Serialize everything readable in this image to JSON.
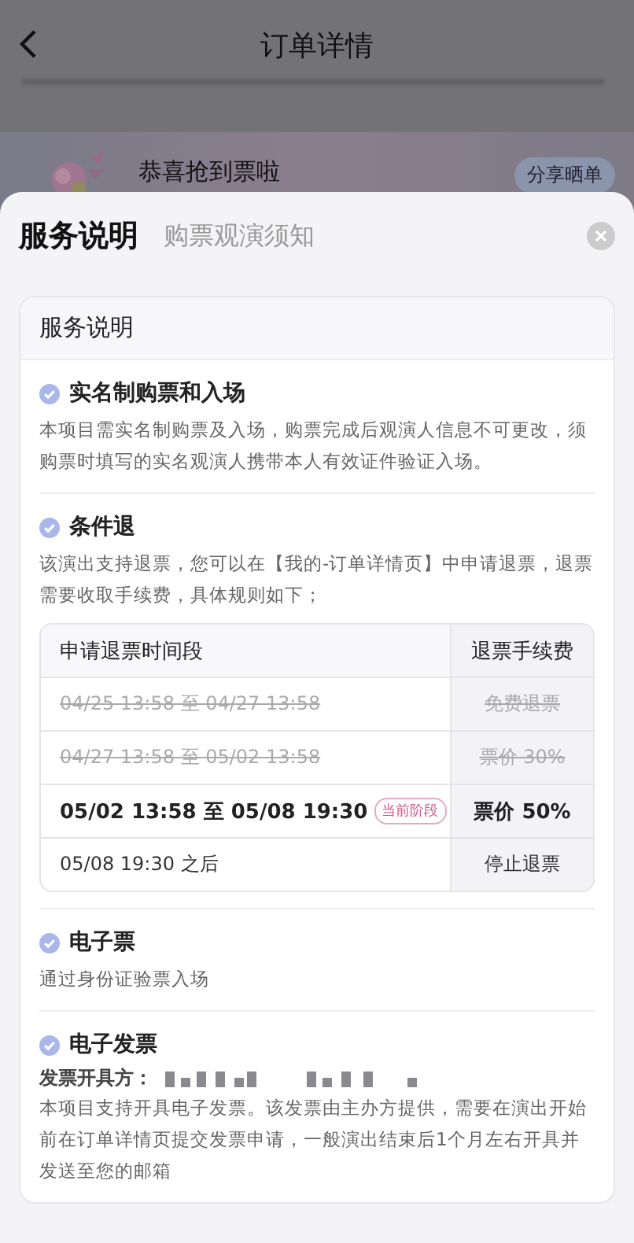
{
  "header": {
    "title": "订单详情"
  },
  "banner": {
    "title": "恭喜抢到票啦",
    "button": "分享晒单"
  },
  "sheet": {
    "tabs": [
      {
        "label": "服务说明",
        "selected": true
      },
      {
        "label": "购票观演须知",
        "selected": false
      }
    ],
    "card": {
      "title": "服务说明",
      "sections": [
        {
          "kind": "text",
          "title": "实名制购票和入场",
          "body": "本项目需实名制购票及入场，购票完成后观演人信息不可更改，须购票时填写的实名观演人携带本人有效证件验证入场。"
        },
        {
          "kind": "table",
          "title": "条件退",
          "body": "该演出支持退票，您可以在【我的-订单详情页】中申请退票，退票需要收取手续费，具体规则如下；",
          "columns": [
            "申请退票时间段",
            "退票手续费"
          ],
          "rows": [
            {
              "expired": true,
              "current": false,
              "period": "04/25 13:58 至 04/27 13:58",
              "fee": "免费退票"
            },
            {
              "expired": true,
              "current": false,
              "period": "04/27 13:58 至 05/02 13:58",
              "fee": "票价 30%"
            },
            {
              "expired": false,
              "current": true,
              "period": "05/02 13:58 至 05/08 19:30",
              "badge": "当前阶段",
              "fee": "票价 50%"
            },
            {
              "expired": false,
              "current": false,
              "period": "05/08 19:30 之后",
              "fee": "停止退票"
            }
          ]
        },
        {
          "kind": "text",
          "title": "电子票",
          "body": "通过身份证验票入场"
        },
        {
          "kind": "invoice",
          "title": "电子发票",
          "label": "发票开具方：",
          "body": "本项目支持开具电子发票。该发票由主办方提供，需要在演出开始前在订单详情页提交发票申请，一般演出结束后1个月左右开具并发送至您的邮箱"
        }
      ]
    }
  }
}
